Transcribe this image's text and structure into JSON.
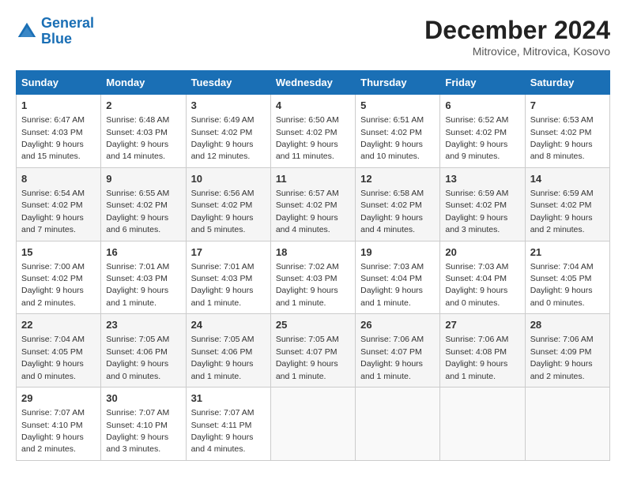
{
  "logo": {
    "line1": "General",
    "line2": "Blue"
  },
  "title": "December 2024",
  "subtitle": "Mitrovice, Mitrovica, Kosovo",
  "days_of_week": [
    "Sunday",
    "Monday",
    "Tuesday",
    "Wednesday",
    "Thursday",
    "Friday",
    "Saturday"
  ],
  "weeks": [
    [
      {
        "day": "1",
        "sunrise": "6:47 AM",
        "sunset": "4:03 PM",
        "daylight": "9 hours and 15 minutes."
      },
      {
        "day": "2",
        "sunrise": "6:48 AM",
        "sunset": "4:03 PM",
        "daylight": "9 hours and 14 minutes."
      },
      {
        "day": "3",
        "sunrise": "6:49 AM",
        "sunset": "4:02 PM",
        "daylight": "9 hours and 12 minutes."
      },
      {
        "day": "4",
        "sunrise": "6:50 AM",
        "sunset": "4:02 PM",
        "daylight": "9 hours and 11 minutes."
      },
      {
        "day": "5",
        "sunrise": "6:51 AM",
        "sunset": "4:02 PM",
        "daylight": "9 hours and 10 minutes."
      },
      {
        "day": "6",
        "sunrise": "6:52 AM",
        "sunset": "4:02 PM",
        "daylight": "9 hours and 9 minutes."
      },
      {
        "day": "7",
        "sunrise": "6:53 AM",
        "sunset": "4:02 PM",
        "daylight": "9 hours and 8 minutes."
      }
    ],
    [
      {
        "day": "8",
        "sunrise": "6:54 AM",
        "sunset": "4:02 PM",
        "daylight": "9 hours and 7 minutes."
      },
      {
        "day": "9",
        "sunrise": "6:55 AM",
        "sunset": "4:02 PM",
        "daylight": "9 hours and 6 minutes."
      },
      {
        "day": "10",
        "sunrise": "6:56 AM",
        "sunset": "4:02 PM",
        "daylight": "9 hours and 5 minutes."
      },
      {
        "day": "11",
        "sunrise": "6:57 AM",
        "sunset": "4:02 PM",
        "daylight": "9 hours and 4 minutes."
      },
      {
        "day": "12",
        "sunrise": "6:58 AM",
        "sunset": "4:02 PM",
        "daylight": "9 hours and 4 minutes."
      },
      {
        "day": "13",
        "sunrise": "6:59 AM",
        "sunset": "4:02 PM",
        "daylight": "9 hours and 3 minutes."
      },
      {
        "day": "14",
        "sunrise": "6:59 AM",
        "sunset": "4:02 PM",
        "daylight": "9 hours and 2 minutes."
      }
    ],
    [
      {
        "day": "15",
        "sunrise": "7:00 AM",
        "sunset": "4:02 PM",
        "daylight": "9 hours and 2 minutes."
      },
      {
        "day": "16",
        "sunrise": "7:01 AM",
        "sunset": "4:03 PM",
        "daylight": "9 hours and 1 minute."
      },
      {
        "day": "17",
        "sunrise": "7:01 AM",
        "sunset": "4:03 PM",
        "daylight": "9 hours and 1 minute."
      },
      {
        "day": "18",
        "sunrise": "7:02 AM",
        "sunset": "4:03 PM",
        "daylight": "9 hours and 1 minute."
      },
      {
        "day": "19",
        "sunrise": "7:03 AM",
        "sunset": "4:04 PM",
        "daylight": "9 hours and 1 minute."
      },
      {
        "day": "20",
        "sunrise": "7:03 AM",
        "sunset": "4:04 PM",
        "daylight": "9 hours and 0 minutes."
      },
      {
        "day": "21",
        "sunrise": "7:04 AM",
        "sunset": "4:05 PM",
        "daylight": "9 hours and 0 minutes."
      }
    ],
    [
      {
        "day": "22",
        "sunrise": "7:04 AM",
        "sunset": "4:05 PM",
        "daylight": "9 hours and 0 minutes."
      },
      {
        "day": "23",
        "sunrise": "7:05 AM",
        "sunset": "4:06 PM",
        "daylight": "9 hours and 0 minutes."
      },
      {
        "day": "24",
        "sunrise": "7:05 AM",
        "sunset": "4:06 PM",
        "daylight": "9 hours and 1 minute."
      },
      {
        "day": "25",
        "sunrise": "7:05 AM",
        "sunset": "4:07 PM",
        "daylight": "9 hours and 1 minute."
      },
      {
        "day": "26",
        "sunrise": "7:06 AM",
        "sunset": "4:07 PM",
        "daylight": "9 hours and 1 minute."
      },
      {
        "day": "27",
        "sunrise": "7:06 AM",
        "sunset": "4:08 PM",
        "daylight": "9 hours and 1 minute."
      },
      {
        "day": "28",
        "sunrise": "7:06 AM",
        "sunset": "4:09 PM",
        "daylight": "9 hours and 2 minutes."
      }
    ],
    [
      {
        "day": "29",
        "sunrise": "7:07 AM",
        "sunset": "4:10 PM",
        "daylight": "9 hours and 2 minutes."
      },
      {
        "day": "30",
        "sunrise": "7:07 AM",
        "sunset": "4:10 PM",
        "daylight": "9 hours and 3 minutes."
      },
      {
        "day": "31",
        "sunrise": "7:07 AM",
        "sunset": "4:11 PM",
        "daylight": "9 hours and 4 minutes."
      },
      null,
      null,
      null,
      null
    ]
  ]
}
